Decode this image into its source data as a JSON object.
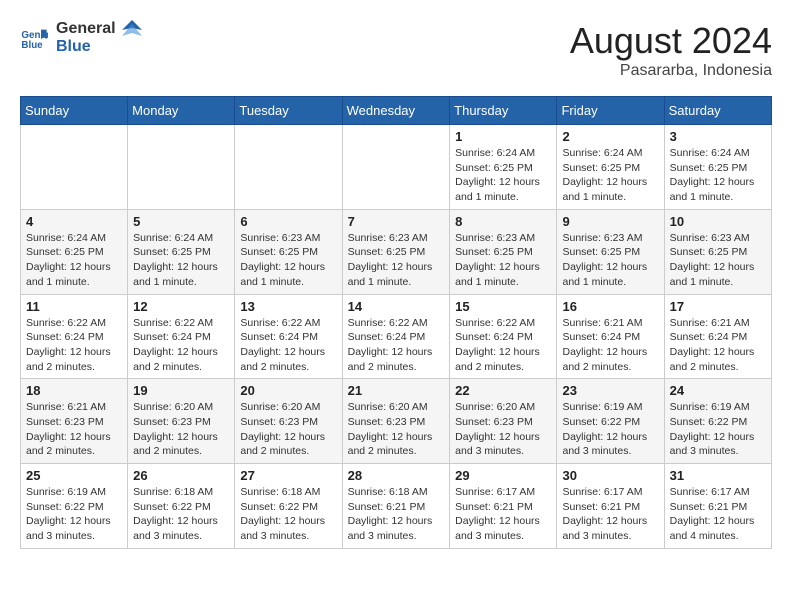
{
  "header": {
    "logo_line1": "General",
    "logo_line2": "Blue",
    "month_year": "August 2024",
    "location": "Pasararba, Indonesia"
  },
  "weekdays": [
    "Sunday",
    "Monday",
    "Tuesday",
    "Wednesday",
    "Thursday",
    "Friday",
    "Saturday"
  ],
  "weeks": [
    [
      {
        "day": "",
        "info": ""
      },
      {
        "day": "",
        "info": ""
      },
      {
        "day": "",
        "info": ""
      },
      {
        "day": "",
        "info": ""
      },
      {
        "day": "1",
        "info": "Sunrise: 6:24 AM\nSunset: 6:25 PM\nDaylight: 12 hours\nand 1 minute."
      },
      {
        "day": "2",
        "info": "Sunrise: 6:24 AM\nSunset: 6:25 PM\nDaylight: 12 hours\nand 1 minute."
      },
      {
        "day": "3",
        "info": "Sunrise: 6:24 AM\nSunset: 6:25 PM\nDaylight: 12 hours\nand 1 minute."
      }
    ],
    [
      {
        "day": "4",
        "info": "Sunrise: 6:24 AM\nSunset: 6:25 PM\nDaylight: 12 hours\nand 1 minute."
      },
      {
        "day": "5",
        "info": "Sunrise: 6:24 AM\nSunset: 6:25 PM\nDaylight: 12 hours\nand 1 minute."
      },
      {
        "day": "6",
        "info": "Sunrise: 6:23 AM\nSunset: 6:25 PM\nDaylight: 12 hours\nand 1 minute."
      },
      {
        "day": "7",
        "info": "Sunrise: 6:23 AM\nSunset: 6:25 PM\nDaylight: 12 hours\nand 1 minute."
      },
      {
        "day": "8",
        "info": "Sunrise: 6:23 AM\nSunset: 6:25 PM\nDaylight: 12 hours\nand 1 minute."
      },
      {
        "day": "9",
        "info": "Sunrise: 6:23 AM\nSunset: 6:25 PM\nDaylight: 12 hours\nand 1 minute."
      },
      {
        "day": "10",
        "info": "Sunrise: 6:23 AM\nSunset: 6:25 PM\nDaylight: 12 hours\nand 1 minute."
      }
    ],
    [
      {
        "day": "11",
        "info": "Sunrise: 6:22 AM\nSunset: 6:24 PM\nDaylight: 12 hours\nand 2 minutes."
      },
      {
        "day": "12",
        "info": "Sunrise: 6:22 AM\nSunset: 6:24 PM\nDaylight: 12 hours\nand 2 minutes."
      },
      {
        "day": "13",
        "info": "Sunrise: 6:22 AM\nSunset: 6:24 PM\nDaylight: 12 hours\nand 2 minutes."
      },
      {
        "day": "14",
        "info": "Sunrise: 6:22 AM\nSunset: 6:24 PM\nDaylight: 12 hours\nand 2 minutes."
      },
      {
        "day": "15",
        "info": "Sunrise: 6:22 AM\nSunset: 6:24 PM\nDaylight: 12 hours\nand 2 minutes."
      },
      {
        "day": "16",
        "info": "Sunrise: 6:21 AM\nSunset: 6:24 PM\nDaylight: 12 hours\nand 2 minutes."
      },
      {
        "day": "17",
        "info": "Sunrise: 6:21 AM\nSunset: 6:24 PM\nDaylight: 12 hours\nand 2 minutes."
      }
    ],
    [
      {
        "day": "18",
        "info": "Sunrise: 6:21 AM\nSunset: 6:23 PM\nDaylight: 12 hours\nand 2 minutes."
      },
      {
        "day": "19",
        "info": "Sunrise: 6:20 AM\nSunset: 6:23 PM\nDaylight: 12 hours\nand 2 minutes."
      },
      {
        "day": "20",
        "info": "Sunrise: 6:20 AM\nSunset: 6:23 PM\nDaylight: 12 hours\nand 2 minutes."
      },
      {
        "day": "21",
        "info": "Sunrise: 6:20 AM\nSunset: 6:23 PM\nDaylight: 12 hours\nand 2 minutes."
      },
      {
        "day": "22",
        "info": "Sunrise: 6:20 AM\nSunset: 6:23 PM\nDaylight: 12 hours\nand 3 minutes."
      },
      {
        "day": "23",
        "info": "Sunrise: 6:19 AM\nSunset: 6:22 PM\nDaylight: 12 hours\nand 3 minutes."
      },
      {
        "day": "24",
        "info": "Sunrise: 6:19 AM\nSunset: 6:22 PM\nDaylight: 12 hours\nand 3 minutes."
      }
    ],
    [
      {
        "day": "25",
        "info": "Sunrise: 6:19 AM\nSunset: 6:22 PM\nDaylight: 12 hours\nand 3 minutes."
      },
      {
        "day": "26",
        "info": "Sunrise: 6:18 AM\nSunset: 6:22 PM\nDaylight: 12 hours\nand 3 minutes."
      },
      {
        "day": "27",
        "info": "Sunrise: 6:18 AM\nSunset: 6:22 PM\nDaylight: 12 hours\nand 3 minutes."
      },
      {
        "day": "28",
        "info": "Sunrise: 6:18 AM\nSunset: 6:21 PM\nDaylight: 12 hours\nand 3 minutes."
      },
      {
        "day": "29",
        "info": "Sunrise: 6:17 AM\nSunset: 6:21 PM\nDaylight: 12 hours\nand 3 minutes."
      },
      {
        "day": "30",
        "info": "Sunrise: 6:17 AM\nSunset: 6:21 PM\nDaylight: 12 hours\nand 3 minutes."
      },
      {
        "day": "31",
        "info": "Sunrise: 6:17 AM\nSunset: 6:21 PM\nDaylight: 12 hours\nand 4 minutes."
      }
    ]
  ]
}
